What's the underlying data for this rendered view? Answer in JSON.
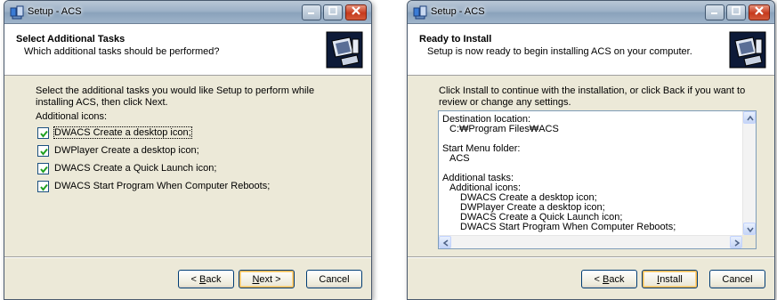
{
  "windows": [
    {
      "title": "Setup - ACS",
      "header_title": "Select Additional Tasks",
      "header_subtitle": "Which additional tasks should be performed?",
      "intro": "Select the additional tasks you would like Setup to perform while installing ACS, then click Next.",
      "section_label": "Additional icons:",
      "tasks": [
        {
          "label": "DWACS Create a desktop icon;",
          "checked": true
        },
        {
          "label": "DWPlayer Create a desktop icon;",
          "checked": true
        },
        {
          "label": "DWACS Create a Quick Launch icon;",
          "checked": true
        },
        {
          "label": "DWACS Start Program When Computer Reboots;",
          "checked": true
        }
      ],
      "buttons": {
        "back_prefix": "< ",
        "back_underlined": "B",
        "back_rest": "ack",
        "next_underlined": "N",
        "next_rest": "ext >",
        "cancel": "Cancel"
      }
    },
    {
      "title": "Setup - ACS",
      "header_title": "Ready to Install",
      "header_subtitle": "Setup is now ready to begin installing ACS on your computer.",
      "intro": "Click Install to continue with the installation, or click Back if you want to review or change any settings.",
      "summary": [
        "Destination location:",
        "C:₩Program Files₩ACS",
        "",
        "Start Menu folder:",
        "ACS",
        "",
        "Additional tasks:",
        "Additional icons:",
        "DWACS Create a desktop icon;",
        "DWPlayer Create a desktop icon;",
        "DWACS Create a Quick Launch icon;",
        "DWACS Start Program When Computer Reboots;"
      ],
      "buttons": {
        "back_prefix": "< ",
        "back_underlined": "B",
        "back_rest": "ack",
        "install_underlined": "I",
        "install_rest": "nstall",
        "cancel": "Cancel"
      }
    }
  ],
  "colors": {
    "dialog_face": "#ece9d8",
    "checkmark": "#21a121",
    "default_button_glow": "#f9b84d"
  },
  "icons": [
    "setup-app-icon",
    "installer-computer-logo",
    "checkmark-icon",
    "scroll-arrow-icon"
  ]
}
